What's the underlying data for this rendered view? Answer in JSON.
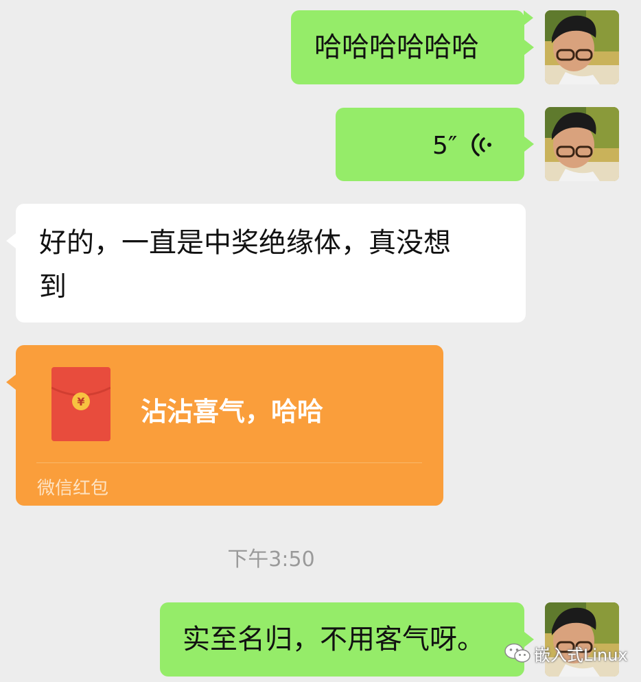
{
  "messages": [
    {
      "side": "right",
      "type": "text",
      "text": "哈哈哈哈哈哈"
    },
    {
      "side": "right",
      "type": "voice",
      "duration": "5″"
    },
    {
      "side": "left",
      "type": "text",
      "line1": "好的，一直是中奖绝缘体，真没想",
      "line2": "到"
    },
    {
      "side": "left",
      "type": "red_packet",
      "greeting": "沾沾喜气，哈哈",
      "footer": "微信红包",
      "coin_symbol": "¥"
    },
    {
      "side": "right",
      "type": "text",
      "text": "实至名归，不用客气呀。"
    }
  ],
  "timestamp": "下午3:50",
  "watermark": "嵌入式Linux",
  "colors": {
    "background": "#ededed",
    "sent_bubble": "#95ec69",
    "received_bubble": "#ffffff",
    "red_packet": "#fa9e3b",
    "red_envelope": "#e84c3d",
    "coin": "#f8c241"
  },
  "icons": [
    "user-avatar",
    "voice-wave-icon",
    "red-envelope-icon",
    "wechat-logo-icon"
  ]
}
